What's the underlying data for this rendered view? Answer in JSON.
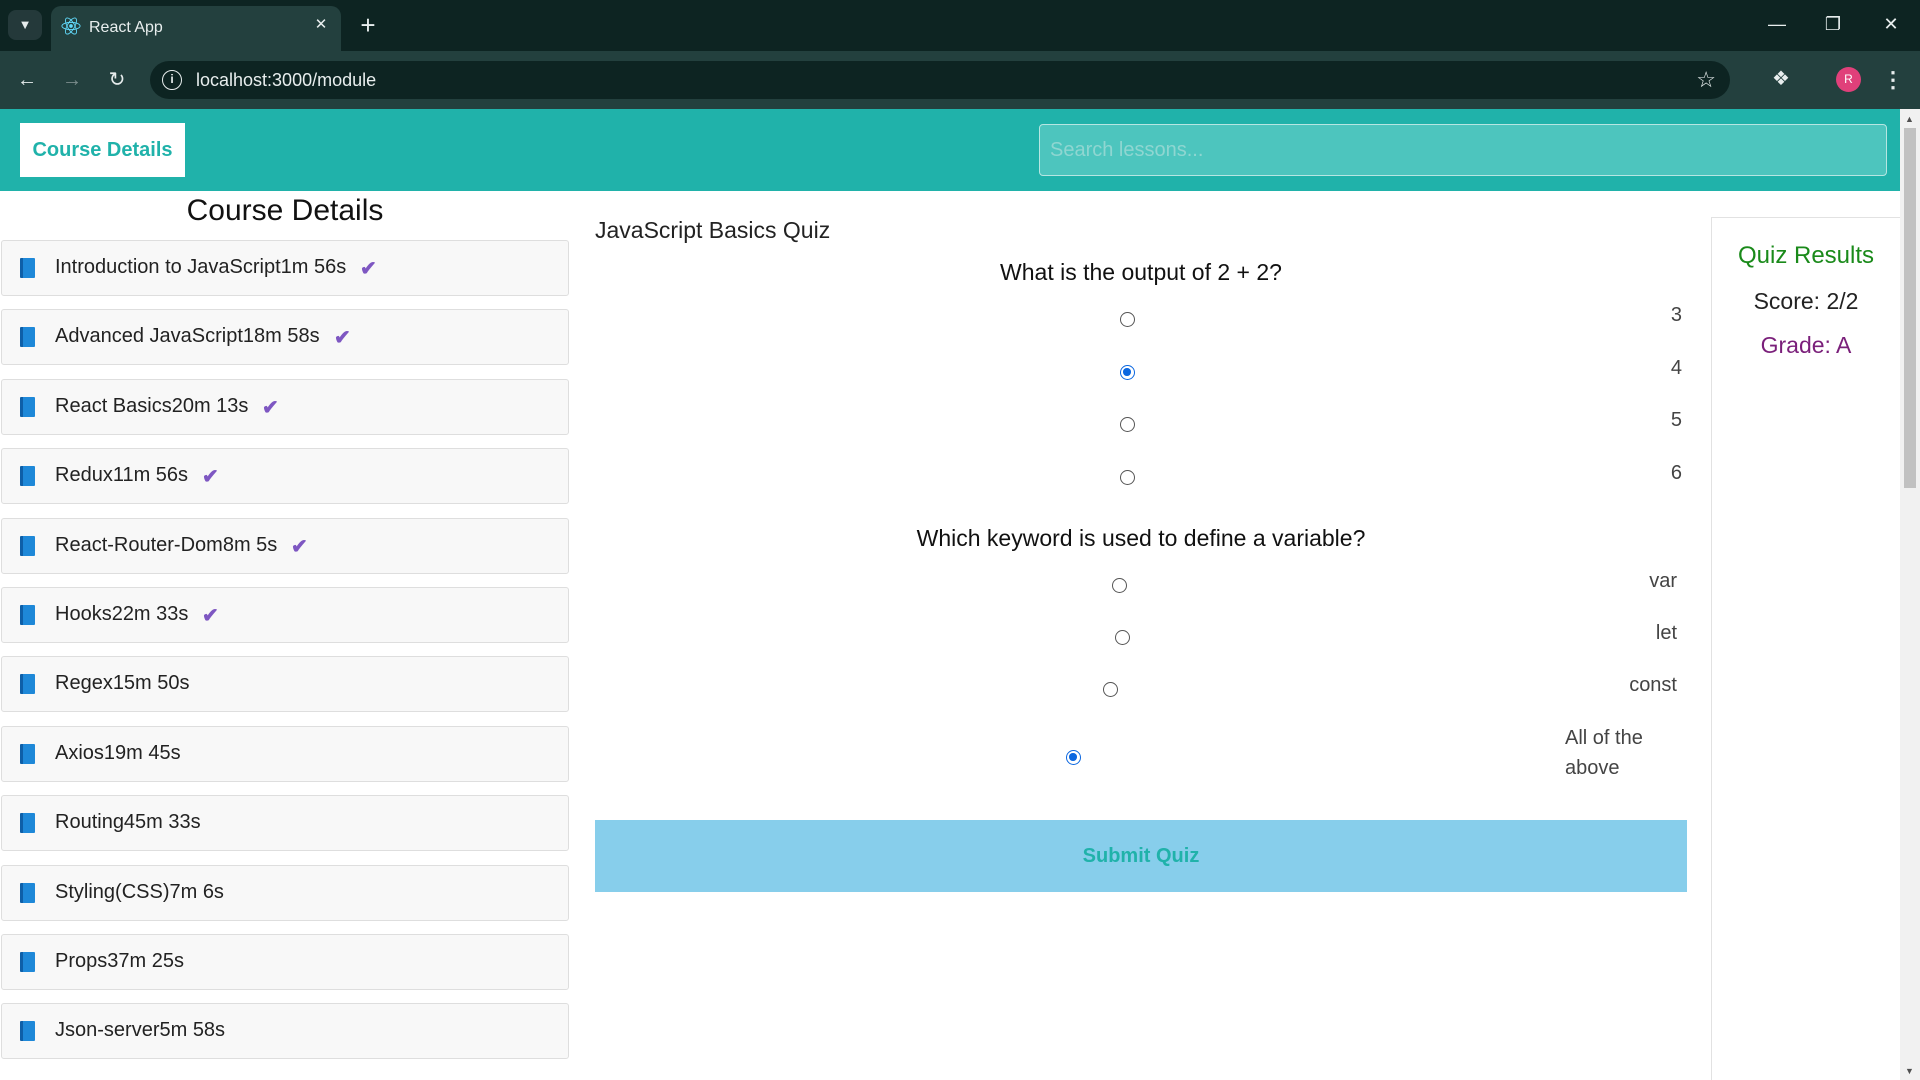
{
  "browser": {
    "tab_title": "React App",
    "url": "localhost:3000/module",
    "avatar_initial": "R"
  },
  "header": {
    "button_label": "Course Details",
    "search_placeholder": "Search lessons..."
  },
  "sidebar": {
    "title": "Course Details",
    "lessons": [
      {
        "label": "Introduction to JavaScript1m 56s",
        "completed": true
      },
      {
        "label": "Advanced JavaScript18m 58s",
        "completed": true
      },
      {
        "label": "React Basics20m 13s",
        "completed": true
      },
      {
        "label": "Redux11m 56s",
        "completed": true
      },
      {
        "label": "React-Router-Dom8m 5s",
        "completed": true
      },
      {
        "label": "Hooks22m 33s",
        "completed": true
      },
      {
        "label": "Regex15m 50s",
        "completed": false
      },
      {
        "label": "Axios19m 45s",
        "completed": false
      },
      {
        "label": "Routing45m 33s",
        "completed": false
      },
      {
        "label": "Styling(CSS)7m 6s",
        "completed": false
      },
      {
        "label": "Props37m 25s",
        "completed": false
      },
      {
        "label": "Json-server5m 58s",
        "completed": false
      }
    ]
  },
  "quiz": {
    "title": "JavaScript Basics Quiz",
    "questions": [
      {
        "text": "What is the output of 2 + 2?",
        "options": [
          {
            "label": "3",
            "selected": false
          },
          {
            "label": "4",
            "selected": true
          },
          {
            "label": "5",
            "selected": false
          },
          {
            "label": "6",
            "selected": false
          }
        ]
      },
      {
        "text": "Which keyword is used to define a variable?",
        "options": [
          {
            "label": "var",
            "selected": false
          },
          {
            "label": "let",
            "selected": false
          },
          {
            "label": "const",
            "selected": false
          },
          {
            "label": "All of the above",
            "selected": true
          }
        ]
      }
    ],
    "submit_label": "Submit Quiz"
  },
  "results": {
    "title": "Quiz Results",
    "score": "Score: 2/2",
    "grade": "Grade: A"
  }
}
